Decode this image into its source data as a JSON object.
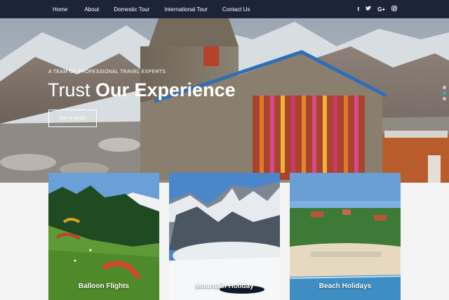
{
  "nav": {
    "links": [
      "Home",
      "About",
      "Domestic Tour",
      "International Tour",
      "Contact Us"
    ],
    "social": [
      {
        "icon": "facebook-icon",
        "glyph": "f"
      },
      {
        "icon": "twitter-icon",
        "glyph": "t"
      },
      {
        "icon": "google-plus-icon",
        "glyph": "G+"
      },
      {
        "icon": "instagram-icon",
        "glyph": "◎"
      }
    ]
  },
  "hero": {
    "tagline": "A TEAM OF PROFESSIONAL TRAVEL EXPERTS",
    "headline_light": "Trust ",
    "headline_bold": "Our Experience",
    "cta_label": "Get in touch",
    "slider_dots": 3,
    "active_dot": 1
  },
  "cards": [
    {
      "title": "Balloon Flights"
    },
    {
      "title": "Mountain Holiday"
    },
    {
      "title": "Beach Holidays"
    }
  ],
  "colors": {
    "nav_bg": "#1b2438",
    "accent": "#2bb6a8",
    "text": "#ffffff"
  }
}
